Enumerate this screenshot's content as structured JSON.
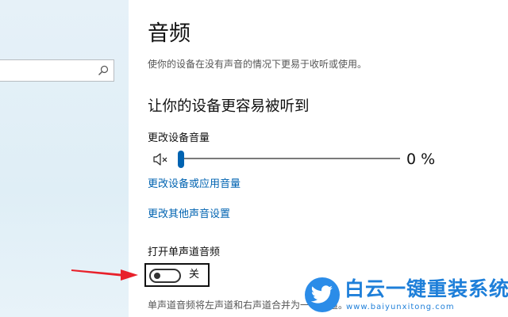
{
  "sidebar": {
    "search": {
      "value": "",
      "placeholder": "",
      "icon": "search-icon"
    }
  },
  "page": {
    "title": "音频",
    "description": "使你的设备在没有声音的情况下更易于收听或使用。"
  },
  "section": {
    "title": "让你的设备更容易被听到",
    "volume": {
      "label": "更改设备音量",
      "value_text": "0 %",
      "value": 0,
      "icon": "mute-speaker-icon"
    },
    "links": {
      "app_volume": "更改设备或应用音量",
      "more_sound": "更改其他声音设置"
    },
    "mono_audio": {
      "label": "打开单声道音频",
      "state_text": "关",
      "on": false,
      "description": "单声道音频将左声道和右声道合并为一个声道。"
    }
  },
  "watermark": {
    "title": "白云一键重装系统",
    "url": "www.baiyunxitong.com"
  },
  "colors": {
    "accent": "#0063b1",
    "annotation_arrow": "#e8212b",
    "watermark": "#1e7fd9"
  }
}
